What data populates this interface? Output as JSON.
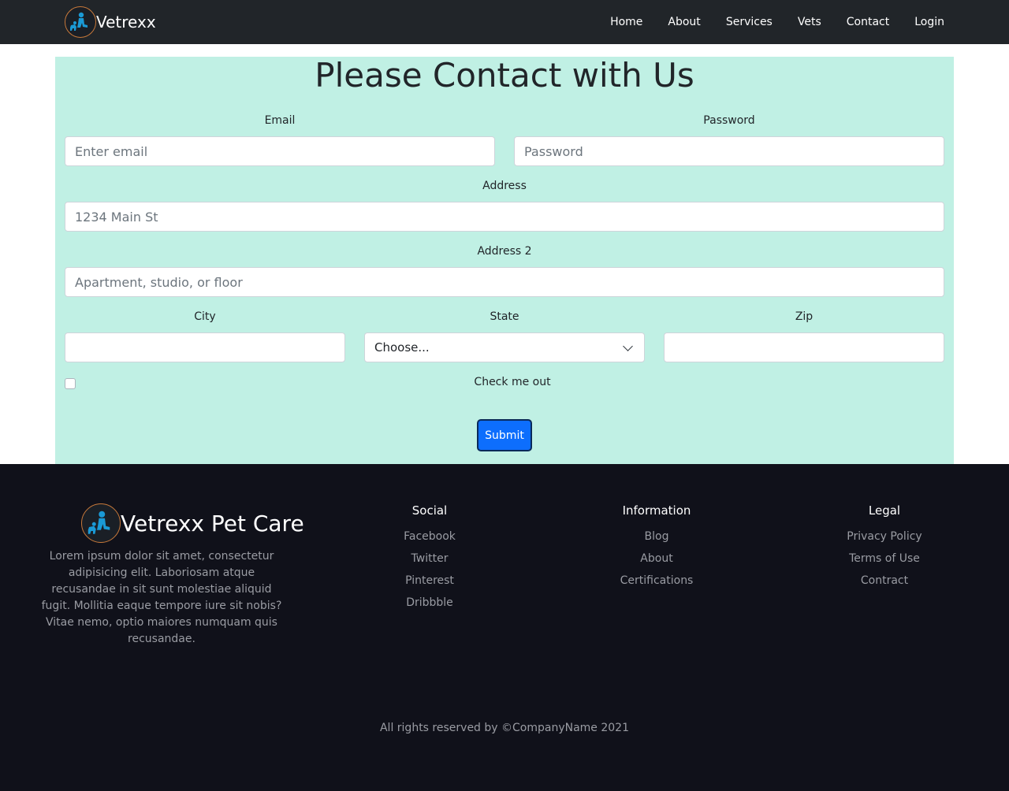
{
  "navbar": {
    "brand": "Vetrexx",
    "links": [
      "Home",
      "About",
      "Services",
      "Vets",
      "Contact",
      "Login"
    ]
  },
  "contact": {
    "title": "Please Contact with Us",
    "email_label": "Email",
    "email_placeholder": "Enter email",
    "password_label": "Password",
    "password_placeholder": "Password",
    "address_label": "Address",
    "address_placeholder": "1234 Main St",
    "address2_label": "Address 2",
    "address2_placeholder": "Apartment, studio, or floor",
    "city_label": "City",
    "state_label": "State",
    "state_selected": "Choose...",
    "zip_label": "Zip",
    "check_label": "Check me out",
    "submit_label": "Submit"
  },
  "footer": {
    "brand": "Vetrexx Pet Care",
    "description": "Lorem ipsum dolor sit amet, consectetur adipisicing elit. Laboriosam atque recusandae in sit sunt molestiae aliquid fugit. Mollitia eaque tempore iure sit nobis? Vitae nemo, optio maiores numquam quis recusandae.",
    "social": {
      "title": "Social",
      "links": [
        "Facebook",
        "Twitter",
        "Pinterest",
        "Dribbble"
      ]
    },
    "information": {
      "title": "Information",
      "links": [
        "Blog",
        "About",
        "Certifications"
      ]
    },
    "legal": {
      "title": "Legal",
      "links": [
        "Privacy Policy",
        "Terms of Use",
        "Contract"
      ]
    },
    "copyright": "All rights reserved by ©CompanyName 2021"
  },
  "colors": {
    "navbar_bg": "#212529",
    "contact_bg": "#c0f0e4",
    "button_primary": "#0d6efd",
    "footer_bg": "#10111a",
    "logo_accent": "#1a9ad6"
  },
  "icons": {
    "logo": "vet-with-dog-icon",
    "select_arrow": "chevron-down-icon"
  }
}
